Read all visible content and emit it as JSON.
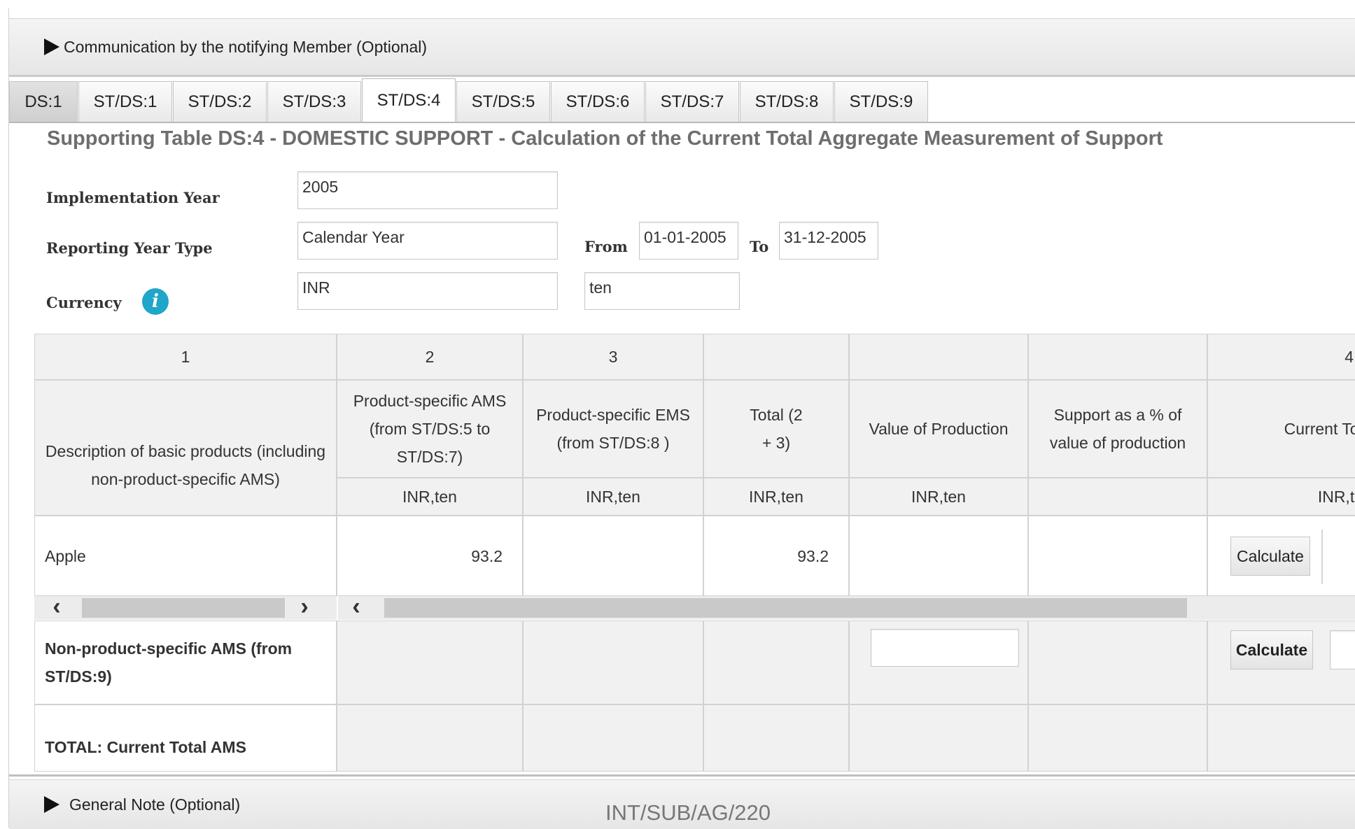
{
  "top_section": {
    "label": "Communication by the notifying Member (Optional)"
  },
  "tabs": [
    "DS:1",
    "ST/DS:1",
    "ST/DS:2",
    "ST/DS:3",
    "ST/DS:4",
    "ST/DS:5",
    "ST/DS:6",
    "ST/DS:7",
    "ST/DS:8",
    "ST/DS:9"
  ],
  "active_tab": "ST/DS:4",
  "page_title": "Supporting Table DS:4 - DOMESTIC SUPPORT - Calculation of the Current Total Aggregate Measurement of Support",
  "form": {
    "implementation_year": {
      "label": "Implementation Year",
      "value": "2005"
    },
    "reporting_year_type": {
      "label": "Reporting Year Type",
      "value": "Calendar Year"
    },
    "from": {
      "label": "From",
      "value": "01-01-2005"
    },
    "to": {
      "label": "To",
      "value": "31-12-2005"
    },
    "currency": {
      "label": "Currency",
      "value": "INR",
      "unit": "ten",
      "info_icon": "info-icon"
    }
  },
  "table": {
    "column_numbers": [
      "1",
      "2",
      "3",
      "",
      "",
      "",
      "4"
    ],
    "column_headers": [
      "Description of basic products (including non-product-specific AMS)",
      "Product-specific AMS (from ST/DS:5 to ST/DS:7)",
      "Product-specific EMS (from ST/DS:8 )",
      "Total (2 + 3)",
      "Value of Production",
      "Support as a % of value of production",
      "Current Tot"
    ],
    "units": [
      "INR,ten",
      "INR,ten",
      "INR,ten",
      "INR,ten",
      "",
      "INR,te"
    ],
    "rows": [
      {
        "product": "Apple",
        "ams": "93.2",
        "ems": "",
        "total": "93.2",
        "value_of_production": "",
        "support_pct": "",
        "button": "Calculate"
      }
    ],
    "non_product_row": {
      "label": "Non-product-specific AMS (from ST/DS:9)",
      "button": "Calculate"
    },
    "total_row": {
      "label": "TOTAL: Current Total AMS"
    }
  },
  "bottom_section": {
    "label": "General Note (Optional)"
  },
  "document_code": "INT/SUB/AG/220"
}
